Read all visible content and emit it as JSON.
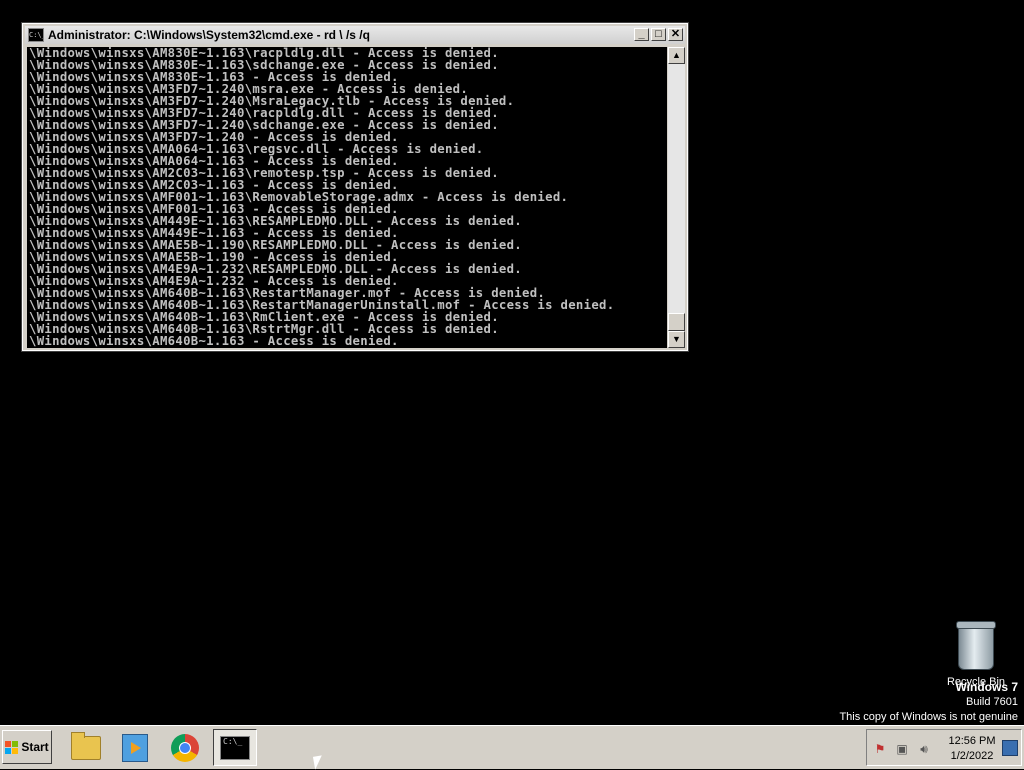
{
  "window": {
    "icon_text": "C:\\_",
    "title": "Administrator: C:\\Windows\\System32\\cmd.exe - rd  \\ /s /q",
    "controls": {
      "minimize": "_",
      "maximize": "□",
      "close": "✕"
    }
  },
  "console": {
    "lines": [
      "\\Windows\\winsxs\\AM830E~1.163\\racpldlg.dll - Access is denied.",
      "\\Windows\\winsxs\\AM830E~1.163\\sdchange.exe - Access is denied.",
      "\\Windows\\winsxs\\AM830E~1.163 - Access is denied.",
      "\\Windows\\winsxs\\AM3FD7~1.240\\msra.exe - Access is denied.",
      "\\Windows\\winsxs\\AM3FD7~1.240\\MsraLegacy.tlb - Access is denied.",
      "\\Windows\\winsxs\\AM3FD7~1.240\\racpldlg.dll - Access is denied.",
      "\\Windows\\winsxs\\AM3FD7~1.240\\sdchange.exe - Access is denied.",
      "\\Windows\\winsxs\\AM3FD7~1.240 - Access is denied.",
      "\\Windows\\winsxs\\AMA064~1.163\\regsvc.dll - Access is denied.",
      "\\Windows\\winsxs\\AMA064~1.163 - Access is denied.",
      "\\Windows\\winsxs\\AM2C03~1.163\\remotesp.tsp - Access is denied.",
      "\\Windows\\winsxs\\AM2C03~1.163 - Access is denied.",
      "\\Windows\\winsxs\\AMF001~1.163\\RemovableStorage.admx - Access is denied.",
      "\\Windows\\winsxs\\AMF001~1.163 - Access is denied.",
      "\\Windows\\winsxs\\AM449E~1.163\\RESAMPLEDMO.DLL - Access is denied.",
      "\\Windows\\winsxs\\AM449E~1.163 - Access is denied.",
      "\\Windows\\winsxs\\AMAE5B~1.190\\RESAMPLEDMO.DLL - Access is denied.",
      "\\Windows\\winsxs\\AMAE5B~1.190 - Access is denied.",
      "\\Windows\\winsxs\\AM4E9A~1.232\\RESAMPLEDMO.DLL - Access is denied.",
      "\\Windows\\winsxs\\AM4E9A~1.232 - Access is denied.",
      "\\Windows\\winsxs\\AM640B~1.163\\RestartManager.mof - Access is denied.",
      "\\Windows\\winsxs\\AM640B~1.163\\RestartManagerUninstall.mof - Access is denied.",
      "\\Windows\\winsxs\\AM640B~1.163\\RmClient.exe - Access is denied.",
      "\\Windows\\winsxs\\AM640B~1.163\\RstrtMgr.dll - Access is denied.",
      "\\Windows\\winsxs\\AM640B~1.163 - Access is denied."
    ]
  },
  "scrollbar": {
    "up": "▲",
    "down": "▼"
  },
  "desktop": {
    "recycle_bin_label": "Recycle Bin",
    "watermark": {
      "os": "Windows 7",
      "build": "Build 7601",
      "genuine": "This copy of Windows is not genuine"
    }
  },
  "taskbar": {
    "start_label": "Start",
    "cmd_icon_text": "C:\\_",
    "tray_icons": [
      "flag-icon",
      "network-icon",
      "volume-icon"
    ],
    "clock": {
      "time": "12:56 PM",
      "date": "1/2/2022"
    }
  }
}
